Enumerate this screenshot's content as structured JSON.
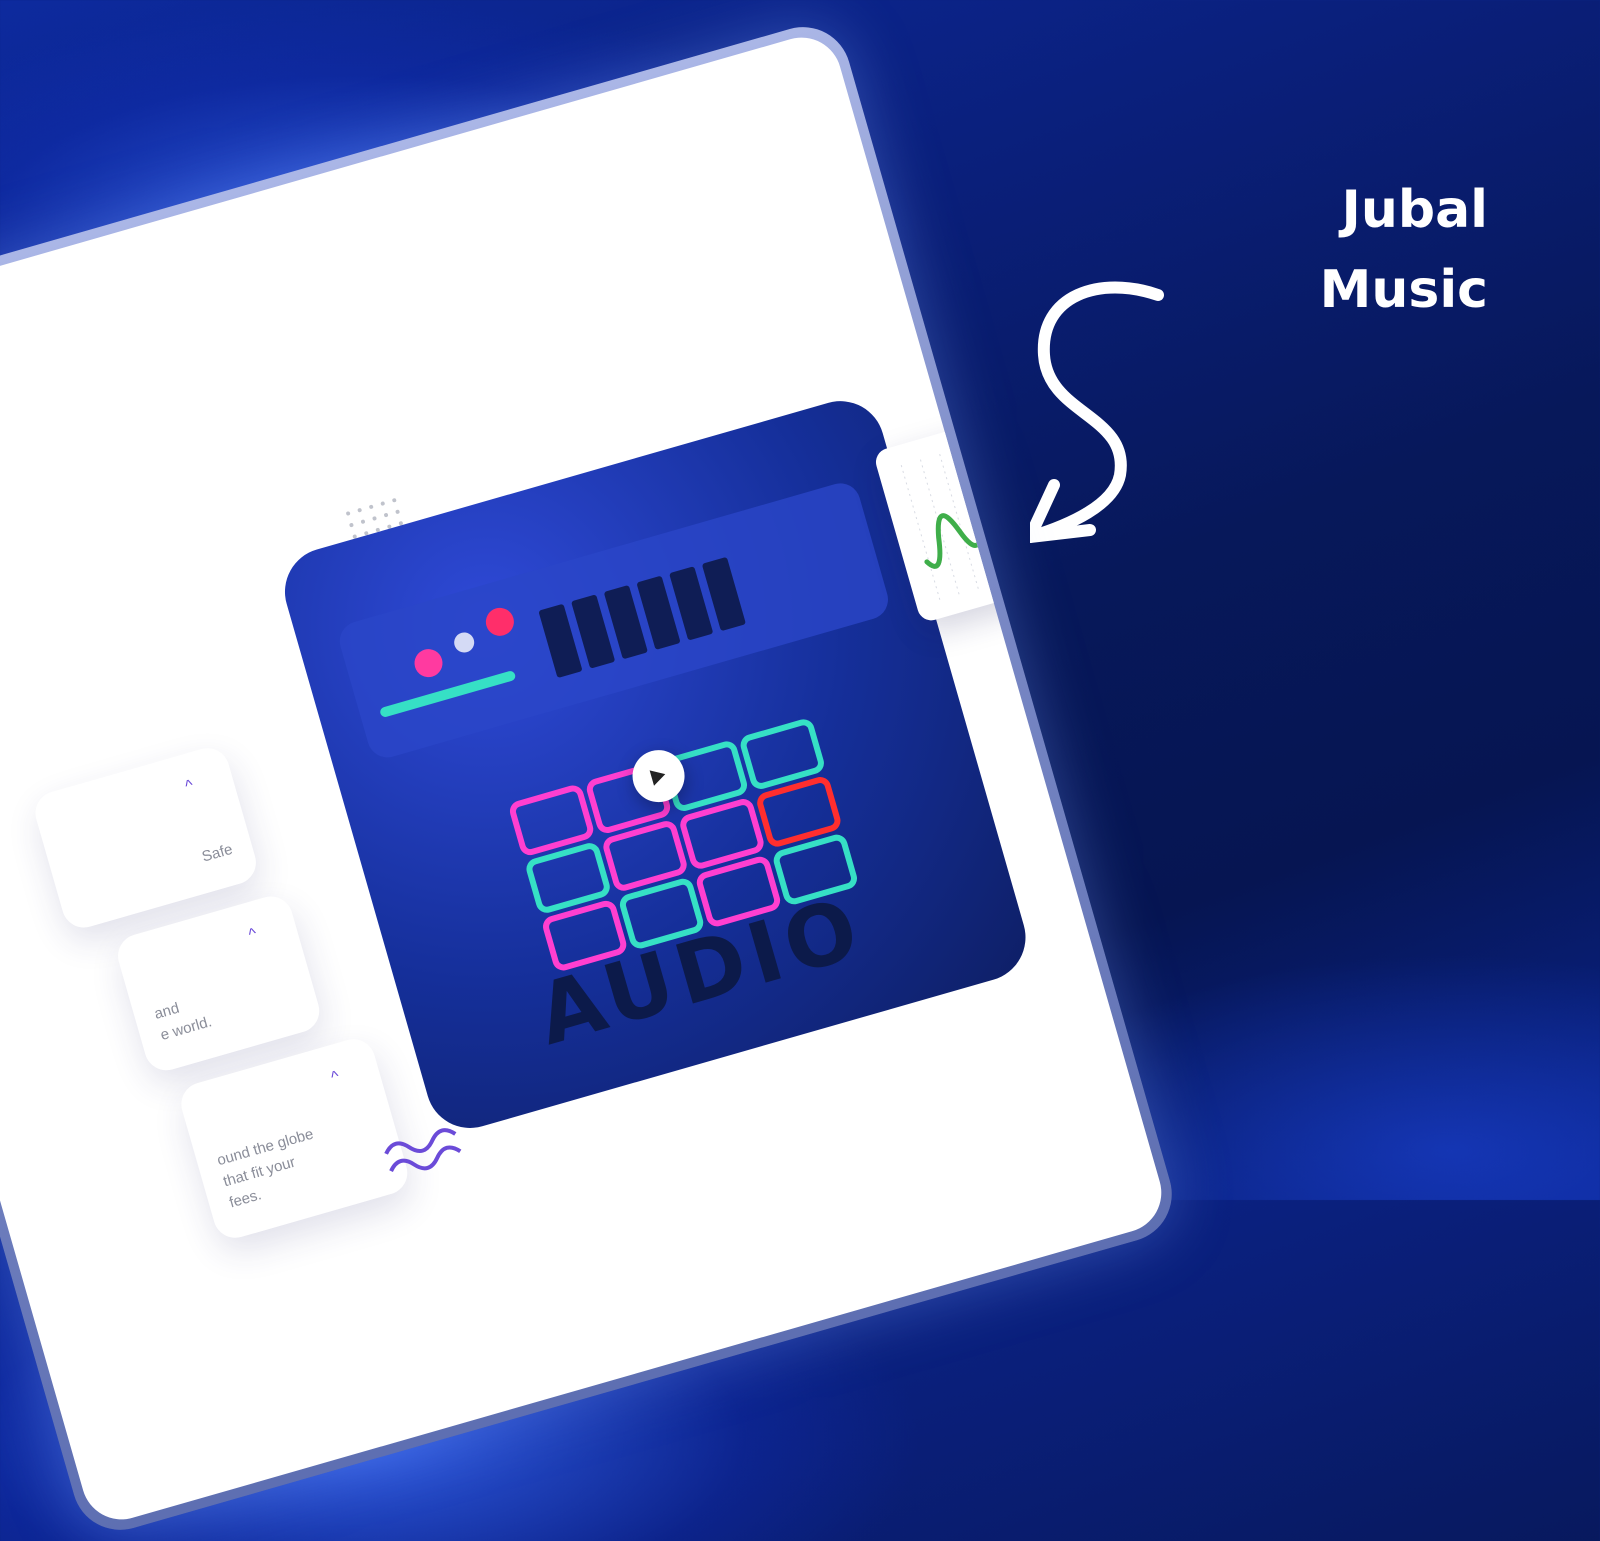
{
  "brand": {
    "line1": "Jubal",
    "line2": "Music"
  },
  "feature_cards": [
    {
      "text": "Safe"
    },
    {
      "text": "and\ne world."
    },
    {
      "text": "ound the globe\n that fit your\nfees."
    }
  ],
  "media": {
    "label": "AUDIO",
    "play_icon": "play-icon"
  },
  "colors": {
    "accent": "#6b4bd8",
    "line": "#3fae4a",
    "point": "#f0a044",
    "background": "#0a1f7a"
  }
}
